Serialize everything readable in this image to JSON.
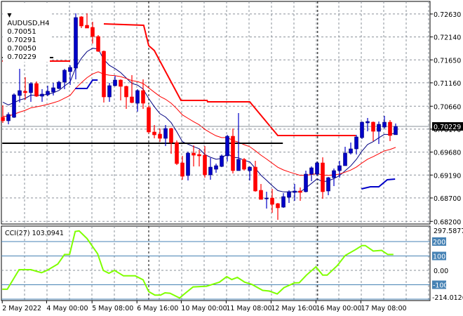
{
  "header": {
    "menu_icon": "triangle-down-icon",
    "symbol": "AUDUSD,H4",
    "open": "0.70051",
    "high": "0.70291",
    "low": "0.70050",
    "close": "0.70229"
  },
  "colors": {
    "bull": "#0000c8",
    "bear": "#ff0000",
    "ma_fast": "#000080",
    "ma_slow": "#ff0000",
    "cci": "#7fff00",
    "cci_levels": "#4682b4",
    "grid": "#8a909a"
  },
  "chart_data": [
    {
      "type": "candlestick",
      "title": "AUDUSD,H4",
      "ylim": [
        0.682,
        0.728
      ],
      "y_ticks": [
        "0.72630",
        "0.72140",
        "0.71650",
        "0.71160",
        "0.70660",
        "0.70170",
        "0.69680",
        "0.69190",
        "0.68700",
        "0.68200"
      ],
      "current_price": "0.70229",
      "x_ticks": [
        {
          "bar": -0.1,
          "label": "2 May 2022"
        },
        {
          "bar": 7.8,
          "label": "4 May 00:00"
        },
        {
          "bar": 15.9,
          "label": "5 May 08:00"
        },
        {
          "bar": 23.9,
          "label": "6 May 16:00"
        },
        {
          "bar": 31.8,
          "label": "10 May 00:00"
        },
        {
          "bar": 39.8,
          "label": "11 May 08:00"
        },
        {
          "bar": 47.8,
          "label": "12 May 16:00"
        },
        {
          "bar": 55.8,
          "label": "16 May 00:00"
        },
        {
          "bar": 63.8,
          "label": "17 May 08:00"
        }
      ],
      "period_separators": [
        26,
        56.1
      ],
      "ohlc": [
        [
          0.70424,
          0.70679,
          0.70304,
          0.70349
        ],
        [
          0.70349,
          0.70529,
          0.70274,
          0.70484
        ],
        [
          0.70424,
          0.70934,
          0.70409,
          0.70904
        ],
        [
          0.70889,
          0.71459,
          0.70739,
          0.70994
        ],
        [
          0.70979,
          0.71279,
          0.70799,
          0.70949
        ],
        [
          0.70949,
          0.71174,
          0.70754,
          0.71144
        ],
        [
          0.71144,
          0.71189,
          0.70859,
          0.70874
        ],
        [
          0.70874,
          0.71024,
          0.70754,
          0.70919
        ],
        [
          0.70904,
          0.71099,
          0.70874,
          0.70979
        ],
        [
          0.70964,
          0.71159,
          0.70889,
          0.71054
        ],
        [
          0.71039,
          0.71204,
          0.71024,
          0.71174
        ],
        [
          0.71174,
          0.71459,
          0.71024,
          0.71429
        ],
        [
          0.71399,
          0.71534,
          0.71114,
          0.71489
        ],
        [
          0.71474,
          0.72644,
          0.71234,
          0.72554
        ],
        [
          0.72569,
          0.72584,
          0.72329,
          0.72374
        ],
        [
          0.72389,
          0.72644,
          0.72329,
          0.72329
        ],
        [
          0.72344,
          0.72464,
          0.71999,
          0.72149
        ],
        [
          0.72149,
          0.72179,
          0.71819,
          0.71834
        ],
        [
          0.71834,
          0.71849,
          0.70739,
          0.70859
        ],
        [
          0.70859,
          0.71159,
          0.70754,
          0.71099
        ],
        [
          0.71099,
          0.71309,
          0.71084,
          0.71219
        ],
        [
          0.71219,
          0.71234,
          0.70784,
          0.71084
        ],
        [
          0.71084,
          0.71099,
          0.70604,
          0.70859
        ],
        [
          0.70859,
          0.71324,
          0.70724,
          0.70739
        ],
        [
          0.70724,
          0.71024,
          0.70544,
          0.70994
        ],
        [
          0.70994,
          0.71234,
          0.70604,
          0.70724
        ],
        [
          0.70634,
          0.70679,
          0.70079,
          0.70109
        ],
        [
          0.70109,
          0.70259,
          0.69974,
          0.70049
        ],
        [
          0.70064,
          0.70184,
          0.69899,
          0.69974
        ],
        [
          0.69974,
          0.70259,
          0.69809,
          0.70184
        ],
        [
          0.70184,
          0.70199,
          0.69644,
          0.69884
        ],
        [
          0.69884,
          0.69929,
          0.69404,
          0.69434
        ],
        [
          0.69449,
          0.69599,
          0.69089,
          0.69164
        ],
        [
          0.69179,
          0.69689,
          0.69074,
          0.69659
        ],
        [
          0.69659,
          0.69824,
          0.69374,
          0.69614
        ],
        [
          0.69629,
          0.69734,
          0.69374,
          0.69599
        ],
        [
          0.69614,
          0.69809,
          0.69134,
          0.69194
        ],
        [
          0.69194,
          0.69554,
          0.69089,
          0.69359
        ],
        [
          0.69314,
          0.69434,
          0.69239,
          0.69389
        ],
        [
          0.69374,
          0.69629,
          0.69359,
          0.69599
        ],
        [
          0.69599,
          0.70049,
          0.69479,
          0.70019
        ],
        [
          0.70019,
          0.70184,
          0.69224,
          0.69284
        ],
        [
          0.69284,
          0.70514,
          0.69284,
          0.69524
        ],
        [
          0.69524,
          0.69554,
          0.69284,
          0.69314
        ],
        [
          0.69284,
          0.69374,
          0.69074,
          0.69359
        ],
        [
          0.69359,
          0.69494,
          0.68834,
          0.68849
        ],
        [
          0.68864,
          0.68999,
          0.68669,
          0.68669
        ],
        [
          0.68684,
          0.68834,
          0.68474,
          0.68699
        ],
        [
          0.68699,
          0.68894,
          0.68384,
          0.68564
        ],
        [
          0.68579,
          0.68594,
          0.68234,
          0.68489
        ],
        [
          0.68504,
          0.68804,
          0.68489,
          0.68729
        ],
        [
          0.68714,
          0.68864,
          0.68594,
          0.68834
        ],
        [
          0.68819,
          0.68999,
          0.68639,
          0.68849
        ],
        [
          0.68849,
          0.68924,
          0.68639,
          0.68819
        ],
        [
          0.68834,
          0.69284,
          0.68819,
          0.69209
        ],
        [
          0.69209,
          0.69374,
          0.69059,
          0.69344
        ],
        [
          0.69209,
          0.69479,
          0.69179,
          0.69449
        ],
        [
          0.69449,
          0.69569,
          0.68684,
          0.68834
        ],
        [
          0.68849,
          0.69149,
          0.68759,
          0.69134
        ],
        [
          0.69134,
          0.69329,
          0.68954,
          0.69284
        ],
        [
          0.69284,
          0.69494,
          0.69134,
          0.69389
        ],
        [
          0.69389,
          0.69794,
          0.69389,
          0.69659
        ],
        [
          0.69659,
          0.69884,
          0.69629,
          0.69749
        ],
        [
          0.69749,
          0.70049,
          0.69629,
          0.70004
        ],
        [
          0.69989,
          0.70334,
          0.69959,
          0.70319
        ],
        [
          0.70304,
          0.70409,
          0.70124,
          0.70334
        ],
        [
          0.70319,
          0.70334,
          0.69914,
          0.70124
        ],
        [
          0.70124,
          0.70334,
          0.69854,
          0.70274
        ],
        [
          0.70214,
          0.70454,
          0.70184,
          0.70319
        ],
        [
          0.70319,
          0.70364,
          0.69914,
          0.70034
        ],
        [
          0.70051,
          0.70291,
          0.7005,
          0.70229
        ]
      ],
      "moving_averages": [
        {
          "name": "fast",
          "period": 8,
          "seed": 0.70859
        },
        {
          "name": "slow",
          "period": 21,
          "seed": 0.70454
        }
      ],
      "resistance_lines": [
        {
          "name": "black-level-1",
          "price": 0.71699,
          "from_bar": -0.1,
          "to_bar": 9
        },
        {
          "name": "black-level-2",
          "price": 0.69869,
          "from_bar": -0.1,
          "to_bar": 49.9
        }
      ],
      "red_step_lines": [
        [
          [
            -0.1,
            0.71624
          ],
          [
            12,
            0.71624
          ]
        ],
        [
          [
            18,
            0.72419
          ],
          [
            25.1,
            0.72389
          ],
          [
            26,
            0.71954
          ],
          [
            27,
            0.71849
          ],
          [
            31.75,
            0.70784
          ],
          [
            36.4,
            0.70784
          ],
          [
            36.5,
            0.70754
          ],
          [
            44,
            0.70754
          ],
          [
            49,
            0.70034
          ],
          [
            62.9,
            0.70034
          ]
        ]
      ],
      "blue_step_lines": [
        [
          [
            12.9,
            0.71039
          ],
          [
            15,
            0.71039
          ],
          [
            16,
            0.71219
          ],
          [
            16.9,
            0.71219
          ]
        ],
        [
          [
            63.9,
            0.68894
          ],
          [
            65.5,
            0.68939
          ],
          [
            67,
            0.68939
          ],
          [
            68.5,
            0.69089
          ],
          [
            69.9,
            0.69104
          ]
        ]
      ]
    },
    {
      "type": "line",
      "title": "CCI(27) 103.0941",
      "ylim": [
        -214.0126,
        297.5877
      ],
      "y_max_label": "297.5877",
      "y_min_label": "-214.0126",
      "levels": [
        "200",
        "100",
        "-100"
      ],
      "zero_label": "0.00",
      "points": [
        [
          -0.1,
          -131
        ],
        [
          0.8,
          -131
        ],
        [
          2.9,
          5
        ],
        [
          5,
          5
        ],
        [
          6.9,
          -16
        ],
        [
          7.9,
          0
        ],
        [
          9.8,
          44
        ],
        [
          11,
          110
        ],
        [
          11.9,
          110
        ],
        [
          12.9,
          270
        ],
        [
          13.6,
          274
        ],
        [
          15,
          221
        ],
        [
          16.9,
          115
        ],
        [
          17.9,
          0
        ],
        [
          18.9,
          -20
        ],
        [
          19.9,
          0
        ],
        [
          21.5,
          -38
        ],
        [
          23.6,
          -38
        ],
        [
          25,
          -66
        ],
        [
          26,
          -148
        ],
        [
          27.1,
          -172
        ],
        [
          28.1,
          -172
        ],
        [
          28.9,
          -156
        ],
        [
          29.8,
          -159
        ],
        [
          31.5,
          -192
        ],
        [
          32.6,
          -156
        ],
        [
          33.9,
          -115
        ],
        [
          36.3,
          -110
        ],
        [
          38.6,
          -82
        ],
        [
          39.9,
          -44
        ],
        [
          40.8,
          -64
        ],
        [
          41.8,
          -49
        ],
        [
          43.1,
          -82
        ],
        [
          44.4,
          -98
        ],
        [
          46.3,
          -139
        ],
        [
          47.5,
          -144
        ],
        [
          48.9,
          -164
        ],
        [
          50.1,
          -120
        ],
        [
          52,
          -87
        ],
        [
          52.8,
          -87
        ],
        [
          54.1,
          -33
        ],
        [
          55.8,
          25
        ],
        [
          57,
          -33
        ],
        [
          57.8,
          -33
        ],
        [
          59.6,
          33
        ],
        [
          61,
          103
        ],
        [
          62.8,
          143
        ],
        [
          64,
          172
        ],
        [
          64.6,
          172
        ],
        [
          66,
          134
        ],
        [
          67.5,
          139
        ],
        [
          68.6,
          110
        ],
        [
          69.6,
          110
        ]
      ]
    }
  ]
}
